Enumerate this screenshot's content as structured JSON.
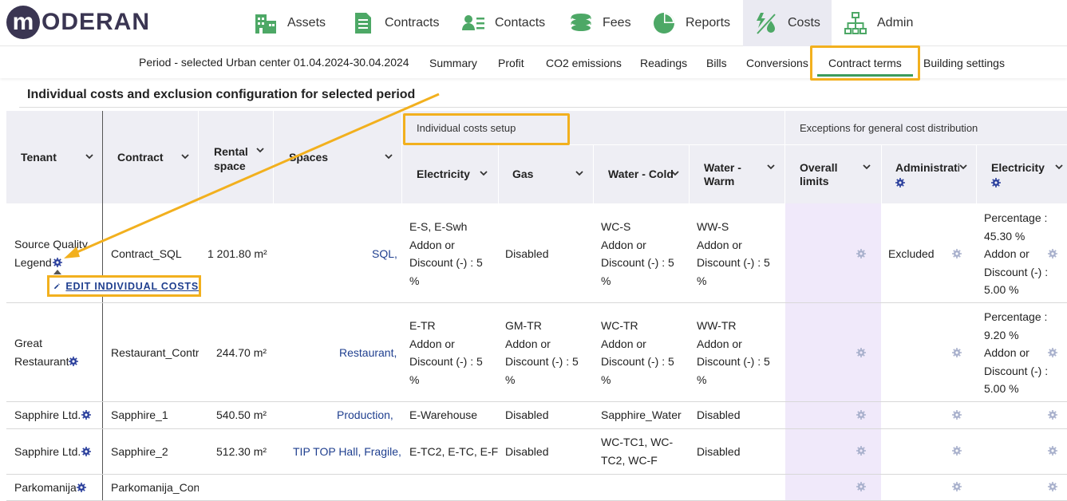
{
  "brand": {
    "logo_letter": "m",
    "logo_text": "ODERAN"
  },
  "nav": {
    "items": [
      {
        "label": "Assets",
        "icon": "buildings-icon"
      },
      {
        "label": "Contracts",
        "icon": "document-icon"
      },
      {
        "label": "Contacts",
        "icon": "contacts-icon"
      },
      {
        "label": "Fees",
        "icon": "coins-icon"
      },
      {
        "label": "Reports",
        "icon": "pie-chart-icon"
      },
      {
        "label": "Costs",
        "icon": "costs-icon",
        "active": true
      },
      {
        "label": "Admin",
        "icon": "hierarchy-icon"
      }
    ]
  },
  "subnav": {
    "period": "Period - selected Urban center 01.04.2024-30.04.2024",
    "tabs": [
      "Summary",
      "Profit",
      "CO2 emissions",
      "Readings",
      "Bills",
      "Conversions",
      "Contract terms",
      "Building settings"
    ],
    "active_tab": "Contract terms"
  },
  "section_title": "Individual costs and exclusion configuration for selected period",
  "table": {
    "headers": {
      "tenant": "Tenant",
      "contract": "Contract",
      "rental_space_1": "Rental",
      "rental_space_2": "space",
      "spaces": "Spaces",
      "group_individual": "Individual costs setup",
      "group_exceptions": "Exceptions for general cost distribution",
      "electricity": "Electricity",
      "gas": "Gas",
      "water_cold": "Water - Cold",
      "water_warm_1": "Water -",
      "water_warm_2": "Warm",
      "overall_1": "Overall",
      "overall_2": "limits",
      "administration": "Administration",
      "ex_electricity": "Electricity"
    },
    "rows": [
      {
        "tenant_1": "Source Quality",
        "tenant_2": "Legend",
        "contract": "Contract_SQL",
        "rental": "1 201.80 m²",
        "spaces": "SQL,",
        "electricity": [
          "E-S, E-Swh",
          "Addon or",
          "Discount (-) : 5",
          "%"
        ],
        "gas": "Disabled",
        "water_cold": [
          "WC-S",
          "Addon or",
          "Discount (-) : 5",
          "%"
        ],
        "water_warm": [
          "WW-S",
          "Addon or",
          "Discount (-) : 5",
          "%"
        ],
        "administration": "Excluded",
        "ex_electricity": [
          "Percentage :",
          "45.30 %",
          "Addon or",
          "Discount (-) :",
          "5.00 %"
        ]
      },
      {
        "tenant_1": "Great",
        "tenant_2": "Restaurant",
        "contract": "Restaurant_Contr",
        "rental": "244.70 m²",
        "spaces": "Restaurant,",
        "electricity": [
          "E-TR",
          "Addon or",
          "Discount (-) : 5",
          "%"
        ],
        "gas": [
          "GM-TR",
          "Addon or",
          "Discount (-) : 5",
          "%"
        ],
        "water_cold": [
          "WC-TR",
          "Addon or",
          "Discount (-) : 5",
          "%"
        ],
        "water_warm": [
          "WW-TR",
          "Addon or",
          "Discount (-) : 5",
          "%"
        ],
        "administration": "",
        "ex_electricity": [
          "Percentage :",
          "9.20 %",
          "Addon or",
          "Discount (-) :",
          "5.00 %"
        ]
      },
      {
        "tenant_1": "Sapphire Ltd.",
        "contract": "Sapphire_1",
        "rental": "540.50 m²",
        "spaces": "Production,",
        "electricity": "E-Warehouse",
        "gas": "Disabled",
        "water_cold": "Sapphire_Water",
        "water_warm": "Disabled"
      },
      {
        "tenant_1": "Sapphire Ltd.",
        "contract": "Sapphire_2",
        "rental": "512.30 m²",
        "spaces": "TIP TOP Hall, Fragile,",
        "electricity": "E-TC2, E-TC, E-F",
        "gas": "Disabled",
        "water_cold": [
          "WC-TC1, WC-",
          "TC2, WC-F"
        ],
        "water_warm": "Disabled"
      },
      {
        "tenant_1": "Parkomanija",
        "contract": "Parkomanija_Con"
      }
    ]
  },
  "popup": {
    "edit_label": "EDIT INDIVIDUAL COSTS",
    "icon": "pencil-icon"
  },
  "colors": {
    "accent_green": "#3d9c5c",
    "highlight": "#f2b01e",
    "link": "#1f3f8f",
    "purple_column": "#f0e9fa",
    "header_bg": "#eeeef4"
  }
}
